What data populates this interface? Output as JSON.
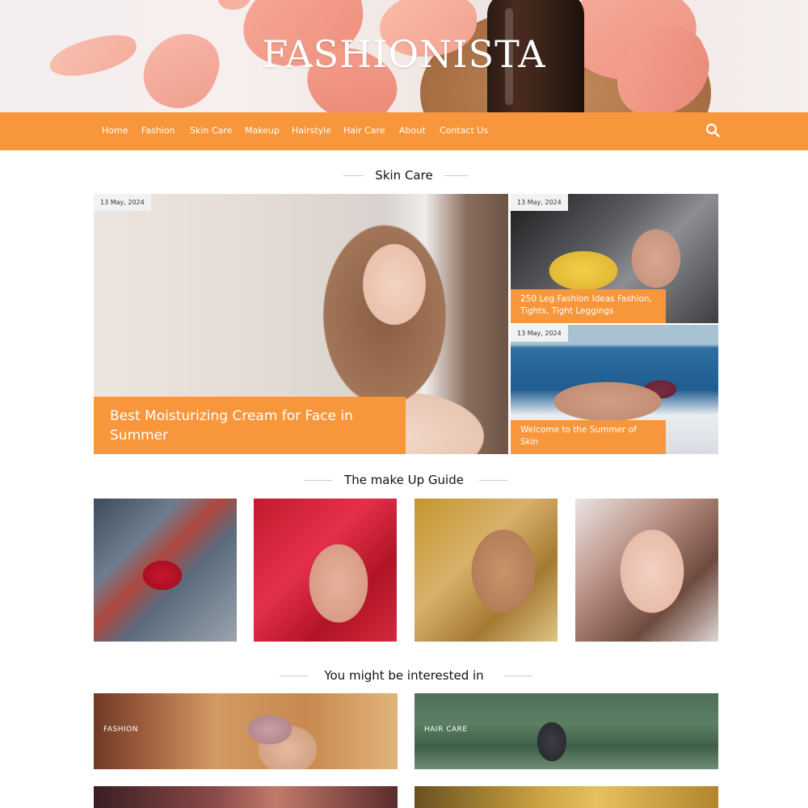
{
  "site": {
    "logo": "FASHIONISTA"
  },
  "nav": {
    "items": [
      "Home",
      "Fashion",
      "Skin Care",
      "Makeup",
      "Hairstyle",
      "Hair Care",
      "About",
      "Contact Us"
    ],
    "search_icon": "search-icon"
  },
  "skin_care": {
    "title": "Skin Care",
    "featured": {
      "date": "13 May, 2024",
      "title": "Best Moisturizing Cream for Face in Summer"
    },
    "side": [
      {
        "date": "13 May, 2024",
        "title": "250 Leg Fashion Ideas Fashion, Tights, Tight Leggings"
      },
      {
        "date": "13 May, 2024",
        "title": "Welcome to the Summer of Skin"
      }
    ]
  },
  "makeup_guide": {
    "title": "The make Up Guide"
  },
  "interested": {
    "title": "You might be interested in",
    "cards": [
      {
        "label": "FASHION"
      },
      {
        "label": "HAIR CARE"
      }
    ]
  },
  "colors": {
    "accent": "#f7963a",
    "background": "#ffffff"
  }
}
